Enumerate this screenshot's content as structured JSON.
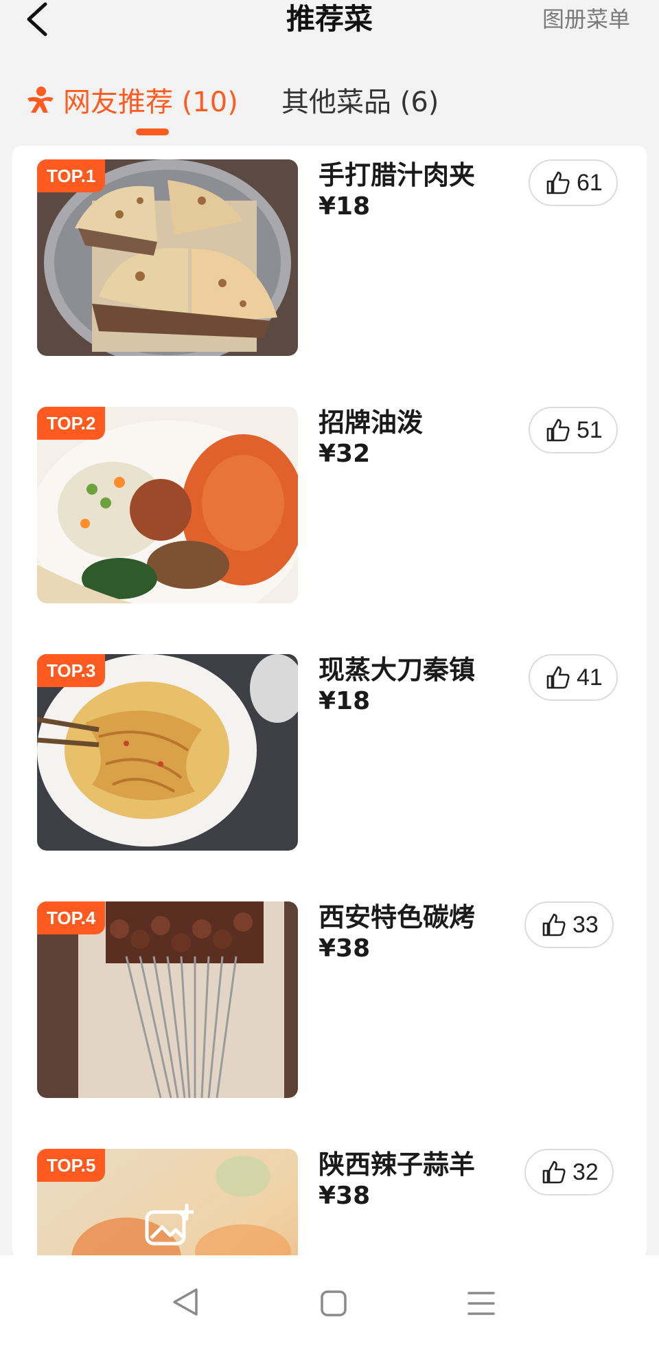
{
  "header": {
    "title": "推荐菜",
    "album_label": "图册菜单"
  },
  "tabs": [
    {
      "label": "网友推荐 (10)",
      "active": true
    },
    {
      "label": "其他菜品 (6)",
      "active": false
    }
  ],
  "colors": {
    "accent": "#ff5a1f",
    "background": "#f3f3f3",
    "card": "#ffffff"
  },
  "dishes": [
    {
      "rank": "TOP.1",
      "name": "手打腊汁肉夹",
      "price": "¥18",
      "likes": "61"
    },
    {
      "rank": "TOP.2",
      "name": "招牌油泼",
      "price": "¥32",
      "likes": "51"
    },
    {
      "rank": "TOP.3",
      "name": "现蒸大刀秦镇",
      "price": "¥18",
      "likes": "41"
    },
    {
      "rank": "TOP.4",
      "name": "西安特色碳烤",
      "price": "¥38",
      "likes": "33"
    },
    {
      "rank": "TOP.5",
      "name": "陕西辣子蒜羊",
      "price": "¥38",
      "likes": "32"
    }
  ],
  "icons": {
    "back": "chevron-left-icon",
    "tab_recommend": "people-icon",
    "like": "thumbs-up-icon",
    "image_placeholder": "add-image-icon",
    "nav_back": "triangle-back-icon",
    "nav_home": "square-home-icon",
    "nav_menu": "menu-lines-icon"
  }
}
